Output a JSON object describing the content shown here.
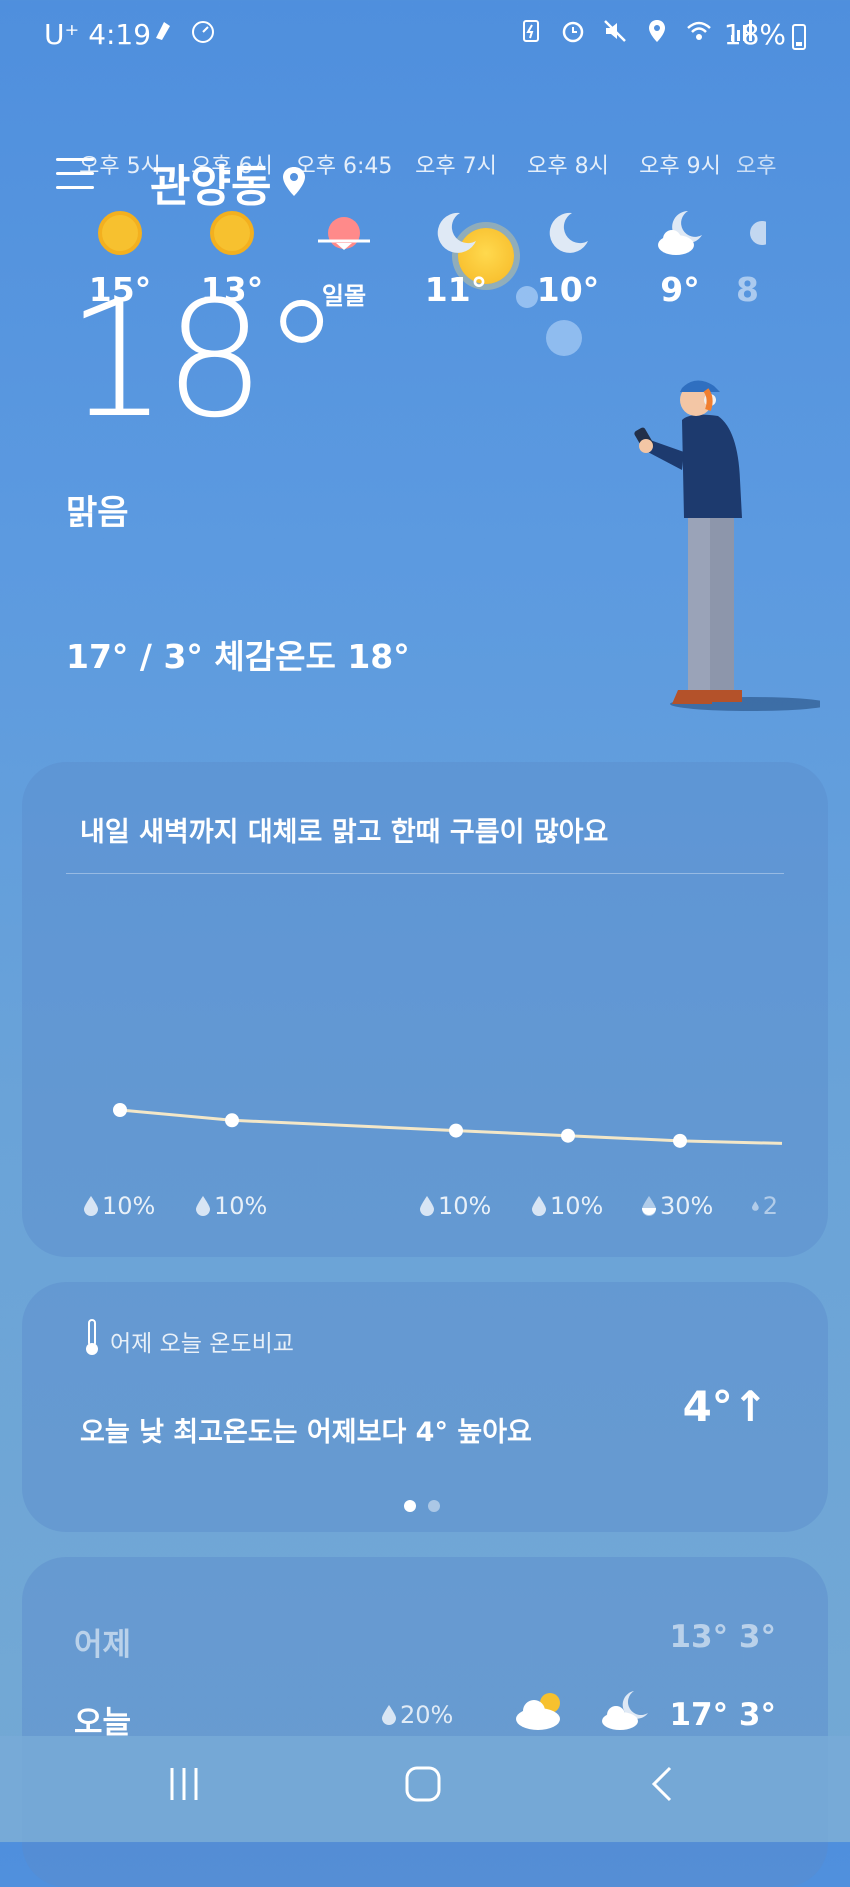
{
  "status_bar": {
    "carrier": "U⁺",
    "time": "4:19",
    "battery": "18%"
  },
  "header": {
    "location": "관양동"
  },
  "current": {
    "temperature": "18°",
    "condition": "맑음",
    "hi_lo_feels": "17° / 3° 체감온도 18°"
  },
  "hourly": {
    "summary": "내일 새벽까지 대체로 맑고 한때 구름이 많아요",
    "items": [
      {
        "time": "오후 5시",
        "icon": "sun-icon",
        "temp": "15°",
        "precip": "10%"
      },
      {
        "time": "오후 6시",
        "icon": "sun-icon",
        "temp": "13°",
        "precip": "10%"
      },
      {
        "time": "오후 6:45",
        "icon": "sunset-icon",
        "temp": "일몰",
        "precip": ""
      },
      {
        "time": "오후 7시",
        "icon": "moon-icon",
        "temp": "11°",
        "precip": "10%"
      },
      {
        "time": "오후 8시",
        "icon": "moon-icon",
        "temp": "10°",
        "precip": "10%"
      },
      {
        "time": "오후 9시",
        "icon": "moon-cloud-icon",
        "temp": "9°",
        "precip": "30%"
      },
      {
        "time": "오후",
        "icon": "moon-cloud-icon",
        "temp": "8",
        "precip": "2"
      }
    ],
    "line_temps": [
      15,
      13,
      11,
      10,
      9,
      8.5
    ]
  },
  "comparison": {
    "title": "어제 오늘 온도비교",
    "text": "오늘 낮 최고온도는 어제보다 4° 높아요",
    "value": "4°↑"
  },
  "daily": {
    "rows": [
      {
        "day": "어제",
        "hilo": "13° 3°"
      },
      {
        "day": "오늘",
        "precip": "20%",
        "hilo": "17° 3°"
      }
    ]
  },
  "colors": {
    "bg_top": "#4f8fdd",
    "sun": "#f6b825",
    "sunset": "#ff8a8a",
    "moon": "#dfe9f5"
  }
}
